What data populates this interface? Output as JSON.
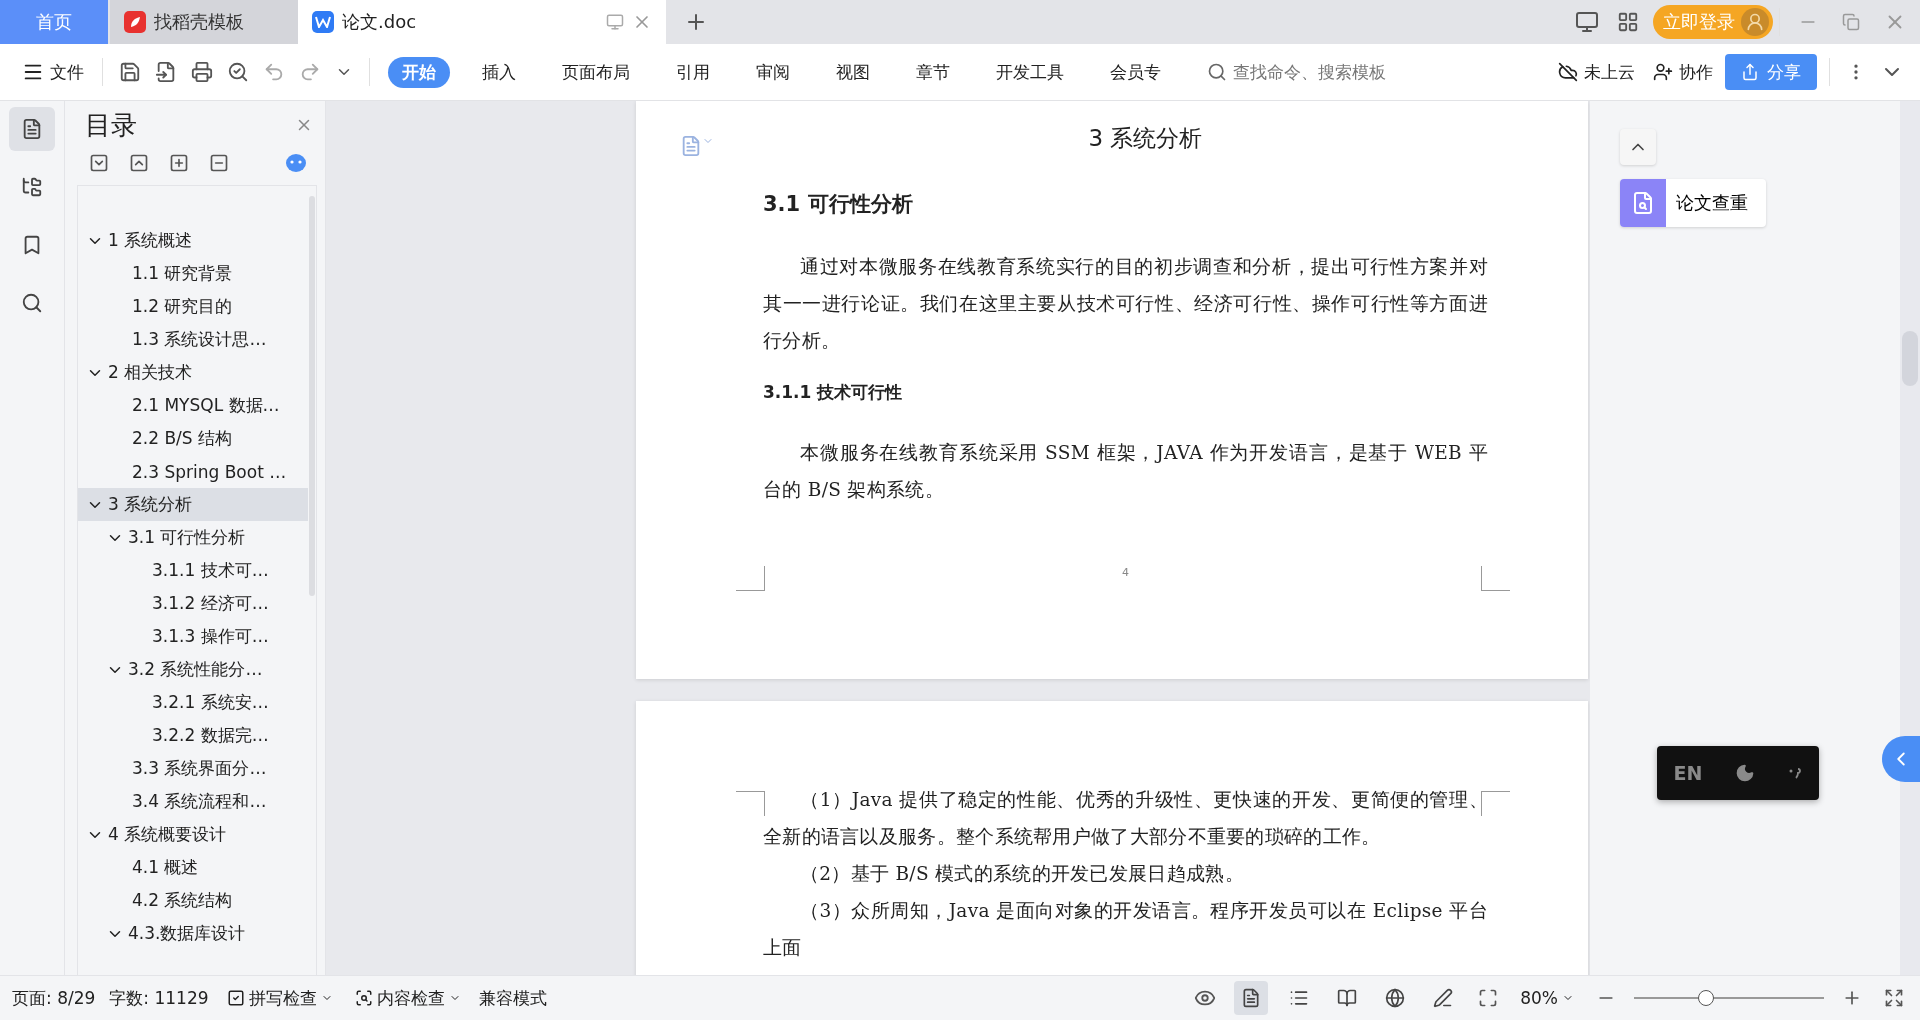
{
  "title_bar": {
    "tabs": [
      {
        "label": "首页",
        "selected": false,
        "kind": "home"
      },
      {
        "label": "找稻壳模板",
        "selected": false,
        "kind": "template"
      },
      {
        "label": "论文.doc",
        "selected": true,
        "kind": "doc"
      }
    ],
    "login": "立即登录"
  },
  "toolbar": {
    "file_menu": "文件",
    "ribbon_tabs": [
      {
        "label": "开始",
        "selected": true
      },
      {
        "label": "插入",
        "selected": false
      },
      {
        "label": "页面布局",
        "selected": false
      },
      {
        "label": "引用",
        "selected": false
      },
      {
        "label": "审阅",
        "selected": false
      },
      {
        "label": "视图",
        "selected": false
      },
      {
        "label": "章节",
        "selected": false
      },
      {
        "label": "开发工具",
        "selected": false
      },
      {
        "label": "会员专",
        "selected": false
      }
    ],
    "search": {
      "placeholder": "查找命令、搜索模板"
    },
    "cloud": "未上云",
    "collab": "协作",
    "share": "分享"
  },
  "toc": {
    "title": "目录",
    "items": [
      {
        "label": "1 系统概述",
        "selected": false,
        "expanded": true,
        "children": [
          {
            "label": "1.1  研究背景",
            "selected": false
          },
          {
            "label": "1.2 研究目的",
            "selected": false
          },
          {
            "label": "1.3 系统设计思…",
            "selected": false
          }
        ]
      },
      {
        "label": "2 相关技术",
        "selected": false,
        "expanded": true,
        "children": [
          {
            "label": "2.1 MYSQL 数据…",
            "selected": false
          },
          {
            "label": "2.2 B/S 结构",
            "selected": false
          },
          {
            "label": "2.3 Spring Boot …",
            "selected": false
          }
        ]
      },
      {
        "label": "3 系统分析",
        "selected": true,
        "expanded": true,
        "children": [
          {
            "label": "3.1 可行性分析",
            "selected": false,
            "expanded": true,
            "children": [
              {
                "label": "3.1.1 技术可…",
                "selected": false
              },
              {
                "label": "3.1.2 经济可…",
                "selected": false
              },
              {
                "label": "3.1.3 操作可…",
                "selected": false
              }
            ]
          },
          {
            "label": "3.2 系统性能分…",
            "selected": false,
            "expanded": true,
            "children": [
              {
                "label": "3.2.1  系统安…",
                "selected": false
              },
              {
                "label": "3.2.2  数据完…",
                "selected": false
              }
            ]
          },
          {
            "label": "3.3 系统界面分…",
            "selected": false
          },
          {
            "label": "3.4 系统流程和…",
            "selected": false
          }
        ]
      },
      {
        "label": "4 系统概要设计",
        "selected": false,
        "expanded": true,
        "children": [
          {
            "label": "4.1 概述",
            "selected": false
          },
          {
            "label": "4.2 系统结构",
            "selected": false
          },
          {
            "label": "4.3.数据库设计",
            "selected": false,
            "expanded": true
          }
        ]
      }
    ]
  },
  "document": {
    "pages": [
      {
        "header_title": "3 系统分析",
        "page_number": "4",
        "blocks": [
          {
            "kind": "h2",
            "text": "3.1 可行性分析"
          },
          {
            "kind": "para",
            "text": "通过对本微服务在线教育系统实行的目的初步调查和分析，提出可行性方案并对其一一进行论证。我们在这里主要从技术可行性、经济可行性、操作可行性等方面进行分析。"
          },
          {
            "kind": "h3",
            "text": "3.1.1 技术可行性"
          },
          {
            "kind": "para",
            "text": "本微服务在线教育系统采用 SSM 框架，JAVA 作为开发语言，是基于 WEB 平台的 B/S 架构系统。"
          }
        ]
      },
      {
        "blocks": [
          {
            "kind": "para",
            "text": "（1）Java 提供了稳定的性能、优秀的升级性、更快速的开发、更简便的管理、全新的语言以及服务。整个系统帮用户做了大部分不重要的琐碎的工作。"
          },
          {
            "kind": "para",
            "text": "（2）基于 B/S 模式的系统的开发已发展日趋成熟。"
          },
          {
            "kind": "para",
            "text": "（3）众所周知，Java 是面向对象的开发语言。程序开发员可以在 Eclipse 平台上面"
          }
        ]
      }
    ]
  },
  "side_panel": {
    "check_button": "论文查重",
    "ime_language": "EN"
  },
  "status_bar": {
    "page": "页面: 8/29",
    "words": "字数: 11129",
    "spell_check": "拼写检查",
    "content_check": "内容检查",
    "mode": "兼容模式",
    "view_buttons": [
      {
        "kind": "page",
        "selected": true
      },
      {
        "kind": "outline",
        "selected": false
      },
      {
        "kind": "read",
        "selected": false
      },
      {
        "kind": "web",
        "selected": false
      },
      {
        "kind": "pen",
        "selected": false
      }
    ],
    "zoom": "80%",
    "zoom_slider": {
      "level": 0.38
    }
  }
}
